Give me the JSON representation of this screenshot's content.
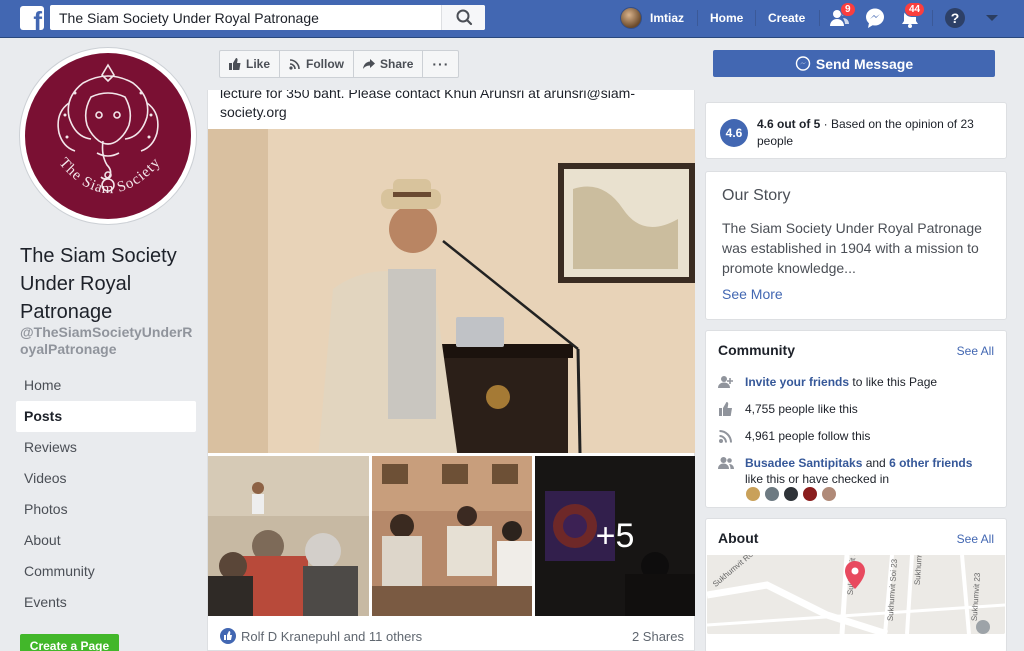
{
  "topbar": {
    "search_value": "The Siam Society Under Royal Patronage",
    "user_name": "Imtiaz",
    "home_label": "Home",
    "create_label": "Create",
    "friend_requests_count": "9",
    "notifications_count": "44",
    "help_label": "?"
  },
  "page": {
    "name": "The Siam Society Under Royal Patronage",
    "handle": "@TheSiamSocietyUnderRoyalPatronage",
    "logo_text": "The Siam Society"
  },
  "sidebar": {
    "items": [
      {
        "label": "Home"
      },
      {
        "label": "Posts"
      },
      {
        "label": "Reviews"
      },
      {
        "label": "Videos"
      },
      {
        "label": "Photos"
      },
      {
        "label": "About"
      },
      {
        "label": "Community"
      },
      {
        "label": "Events"
      }
    ],
    "active": "Posts",
    "create_page_label": "Create a Page"
  },
  "actions": {
    "like_label": "Like",
    "follow_label": "Follow",
    "share_label": "Share",
    "more_label": "···",
    "send_message_label": "Send Message"
  },
  "post": {
    "text": "lecture for 350 baht. Please contact Khun Arunsri at arunsri@siam-society.org",
    "more_photos_label": "+5",
    "reactions_label": "Rolf D Kranepuhl and 11 others",
    "shares_label": "2 Shares"
  },
  "rating": {
    "badge": "4.6",
    "score_label": "4.6 out of 5",
    "detail": " · Based on the opinion of 23 people"
  },
  "story": {
    "title": "Our Story",
    "text": "The Siam Society Under Royal Patronage was established in 1904 with a mission to promote knowledge...",
    "see_more": "See More"
  },
  "community": {
    "title": "Community",
    "see_all": "See All",
    "invite_link": "Invite your friends",
    "invite_rest": " to like this Page",
    "likes": "4,755 people like this",
    "follows": "4,961 people follow this",
    "friend_name": "Busadee Santipitaks",
    "friend_and": " and ",
    "friend_others": "6 other friends",
    "friend_rest": "like this or have checked in"
  },
  "about": {
    "title": "About",
    "see_all": "See All",
    "map_labels": {
      "road1": "Sukhumvit Road",
      "road2": "Sukhumvit Soi 19",
      "road3": "Sukhumvit Soi 23",
      "road4": "Sukhumvit Soi 21",
      "road5": "Sukhumvit 23"
    }
  },
  "colors": {
    "brand_blue": "#4267b2",
    "profile_maroon": "#7a1033",
    "notification_red": "#fa3e3e",
    "create_green": "#42b72a"
  }
}
